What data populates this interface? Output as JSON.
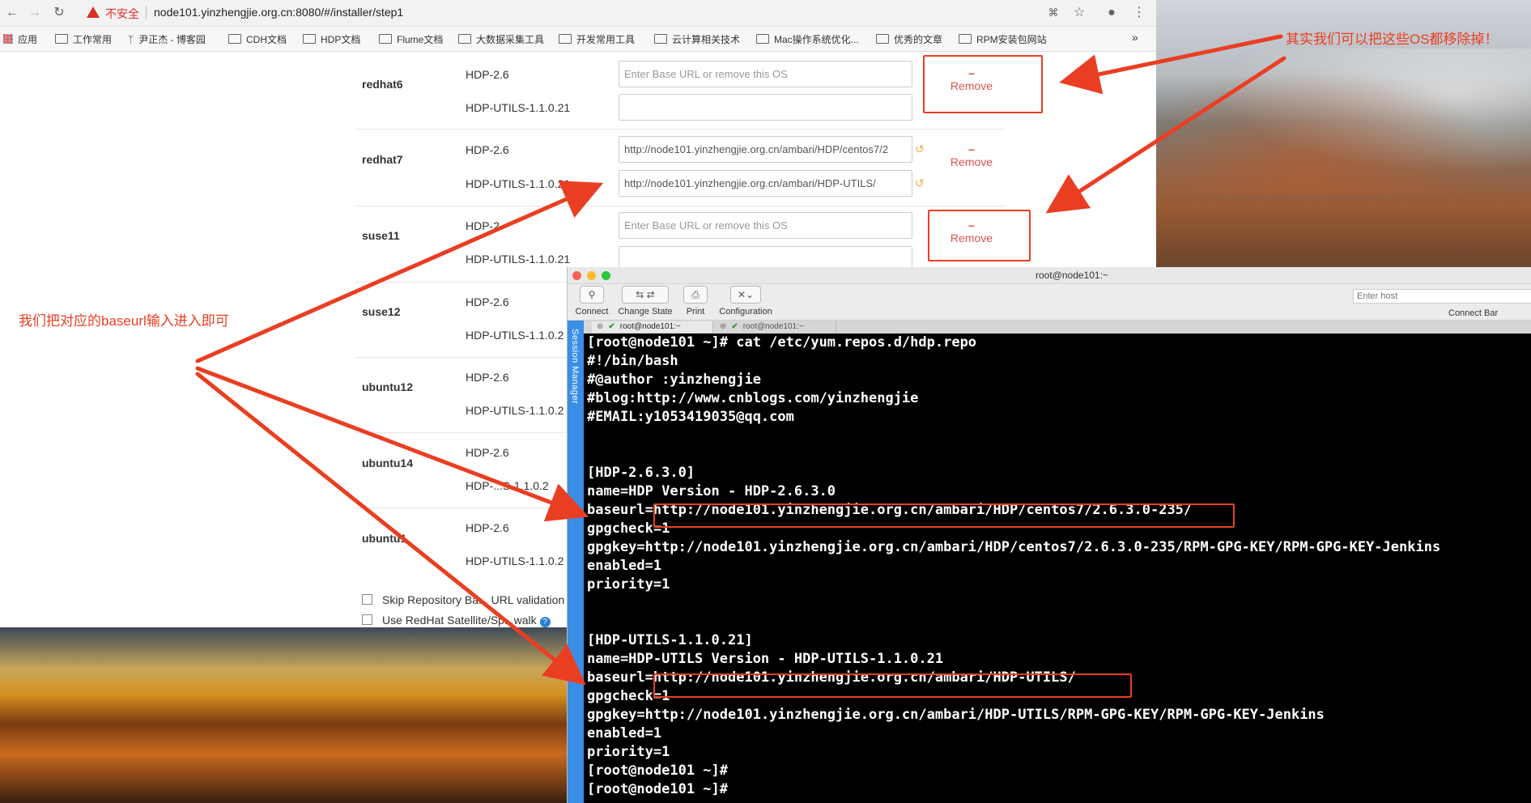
{
  "browser": {
    "warning_text": "不安全",
    "url": "node101.yinzhengjie.org.cn:8080/#/installer/step1",
    "bookmarks": [
      "应用",
      "工作常用",
      "尹正杰 - 博客园",
      "CDH文档",
      "HDP文档",
      "Flume文档",
      "大数据采集工具",
      "开发常用工具",
      "云计算相关技术",
      "Mac操作系统优化...",
      "优秀的文章",
      "RPM安装包网站"
    ],
    "more": "»"
  },
  "installer": {
    "placeholder": "Enter Base URL or remove this OS",
    "remove_label": "Remove",
    "rows": [
      {
        "os": "redhat6",
        "hdp_label": "HDP-2.6",
        "utils_label": "HDP-UTILS-1.1.0.21",
        "hdp_url": "",
        "utils_url": ""
      },
      {
        "os": "redhat7",
        "hdp_label": "HDP-2.6",
        "utils_label": "HDP-UTILS-1.1.0.21",
        "hdp_url": "http://node101.yinzhengjie.org.cn/ambari/HDP/centos7/2",
        "utils_url": "http://node101.yinzhengjie.org.cn/ambari/HDP-UTILS/"
      },
      {
        "os": "suse11",
        "hdp_label": "HDP-2",
        "utils_label": "HDP-UTILS-1.1.0.21",
        "hdp_url": "",
        "utils_url": ""
      },
      {
        "os": "suse12",
        "hdp_label": "HDP-2.6",
        "utils_label": "HDP-UTILS-1.1.0.2"
      },
      {
        "os": "ubuntu12",
        "hdp_label": "HDP-2.6",
        "utils_label": "HDP-UTILS-1.1.0.2"
      },
      {
        "os": "ubuntu14",
        "hdp_label": "HDP-2.6",
        "utils_label": "HDP-...S-1.1.0.2"
      },
      {
        "os": "ubuntu1",
        "hdp_label": "HDP-2.6",
        "utils_label": "HDP-UTILS-1.1.0.2"
      }
    ],
    "checkbox_skip": "Skip Repository Ba... URL validation",
    "checkbox_satellite": "Use RedHat Satellite/Sp...walk",
    "help": "?"
  },
  "annotations": {
    "right_note": "其实我们可以把这些OS都移除掉！",
    "left_note": "我们把对应的baseurl输入进入即可",
    "color": "#ea3e23"
  },
  "terminal": {
    "window_title": "root@node101:~",
    "tools": [
      "Connect",
      "Change State",
      "Print",
      "Configuration"
    ],
    "host_placeholder": "Enter host",
    "connect_bar": "Connect Bar",
    "session_manager": "Session Manager",
    "tabs": [
      "root@node101:~",
      "root@node101:~"
    ],
    "lines": [
      "[root@node101 ~]# cat /etc/yum.repos.d/hdp.repo",
      "#!/bin/bash",
      "#@author :yinzhengjie",
      "#blog:http://www.cnblogs.com/yinzhengjie",
      "#EMAIL:y1053419035@qq.com",
      "",
      "",
      "[HDP-2.6.3.0]",
      "name=HDP Version - HDP-2.6.3.0",
      "baseurl=http://node101.yinzhengjie.org.cn/ambari/HDP/centos7/2.6.3.0-235/",
      "gpgcheck=1",
      "gpgkey=http://node101.yinzhengjie.org.cn/ambari/HDP/centos7/2.6.3.0-235/RPM-GPG-KEY/RPM-GPG-KEY-Jenkins",
      "enabled=1",
      "priority=1",
      "",
      "",
      "[HDP-UTILS-1.1.0.21]",
      "name=HDP-UTILS Version - HDP-UTILS-1.1.0.21",
      "baseurl=http://node101.yinzhengjie.org.cn/ambari/HDP-UTILS/",
      "gpgcheck=1",
      "gpgkey=http://node101.yinzhengjie.org.cn/ambari/HDP-UTILS/RPM-GPG-KEY/RPM-GPG-KEY-Jenkins",
      "enabled=1",
      "priority=1",
      "[root@node101 ~]#",
      "[root@node101 ~]#"
    ]
  }
}
